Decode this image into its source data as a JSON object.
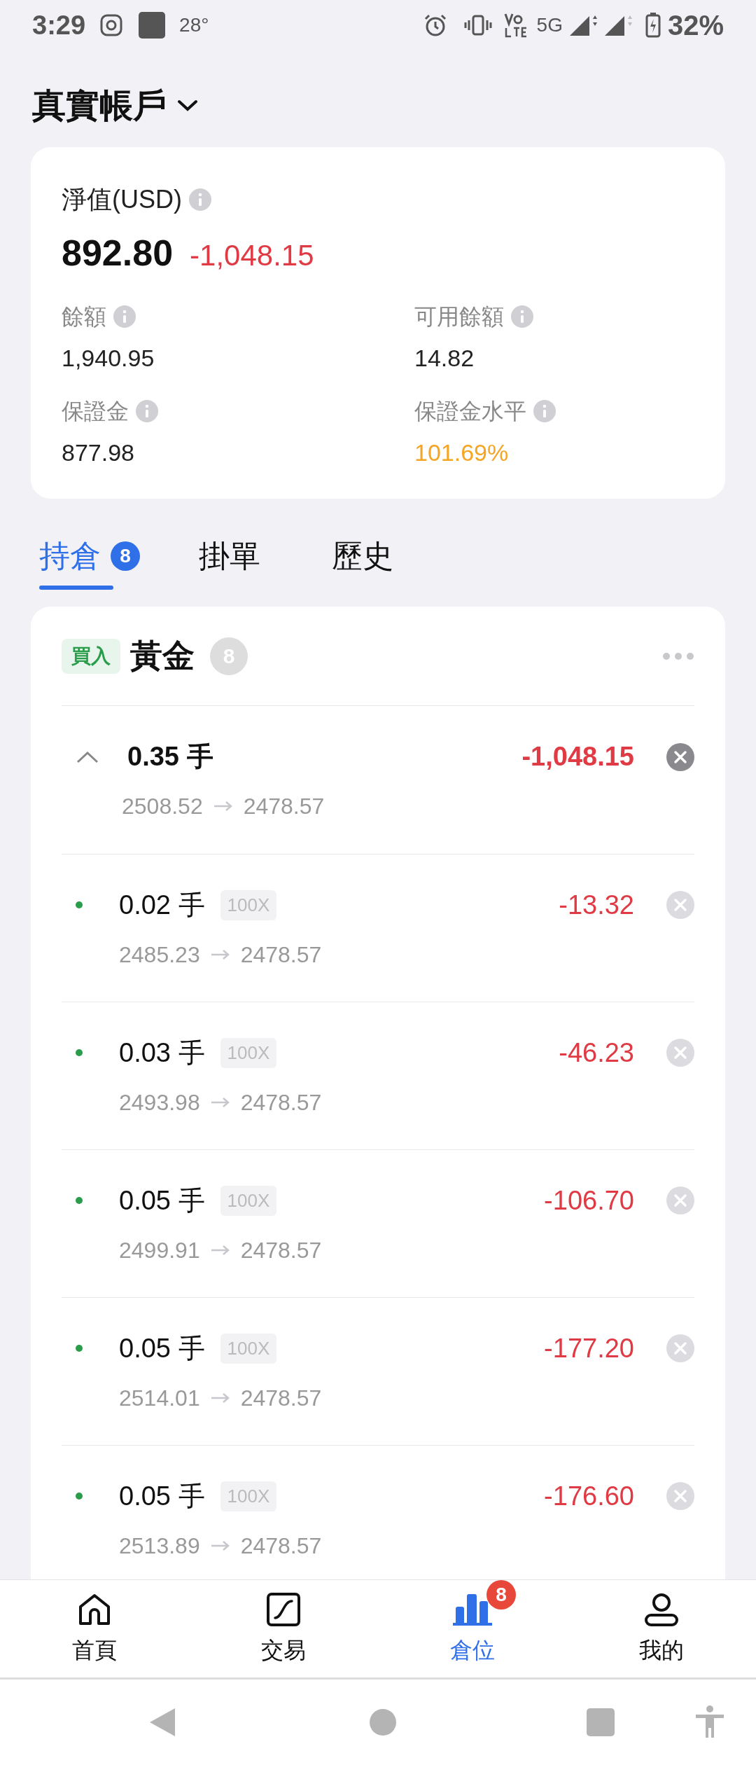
{
  "status_bar": {
    "time": "3:29",
    "temperature": "28°",
    "network": "5G",
    "battery": "32%"
  },
  "account": {
    "title": "真實帳戶"
  },
  "summary": {
    "equity_label": "淨值(USD)",
    "equity": "892.80",
    "pnl": "-1,048.15",
    "fields": [
      {
        "label": "餘額",
        "value": "1,940.95",
        "warn": false
      },
      {
        "label": "可用餘額",
        "value": "14.82",
        "warn": false
      },
      {
        "label": "保證金",
        "value": "877.98",
        "warn": false
      },
      {
        "label": "保證金水平",
        "value": "101.69%",
        "warn": true
      }
    ]
  },
  "tabs": [
    {
      "label": "持倉",
      "badge": "8",
      "selected": true
    },
    {
      "label": "掛單",
      "selected": false
    },
    {
      "label": "歷史",
      "selected": false
    }
  ],
  "group": {
    "side": "買入",
    "symbol": "黃金",
    "count": "8",
    "expanded": true,
    "lots": "0.35 手",
    "pnl": "-1,048.15",
    "open": "2508.52",
    "current": "2478.57",
    "positions": [
      {
        "lots": "0.02 手",
        "leverage": "100X",
        "pnl": "-13.32",
        "open": "2485.23",
        "current": "2478.57"
      },
      {
        "lots": "0.03 手",
        "leverage": "100X",
        "pnl": "-46.23",
        "open": "2493.98",
        "current": "2478.57"
      },
      {
        "lots": "0.05 手",
        "leverage": "100X",
        "pnl": "-106.70",
        "open": "2499.91",
        "current": "2478.57"
      },
      {
        "lots": "0.05 手",
        "leverage": "100X",
        "pnl": "-177.20",
        "open": "2514.01",
        "current": "2478.57"
      },
      {
        "lots": "0.05 手",
        "leverage": "100X",
        "pnl": "-176.60",
        "open": "2513.89",
        "current": "2478.57"
      }
    ]
  },
  "nav": [
    {
      "label": "首頁",
      "kind": "home",
      "selected": false
    },
    {
      "label": "交易",
      "kind": "chart",
      "selected": false
    },
    {
      "label": "倉位",
      "kind": "bars",
      "badge": "8",
      "selected": true
    },
    {
      "label": "我的",
      "kind": "user",
      "selected": false
    }
  ]
}
